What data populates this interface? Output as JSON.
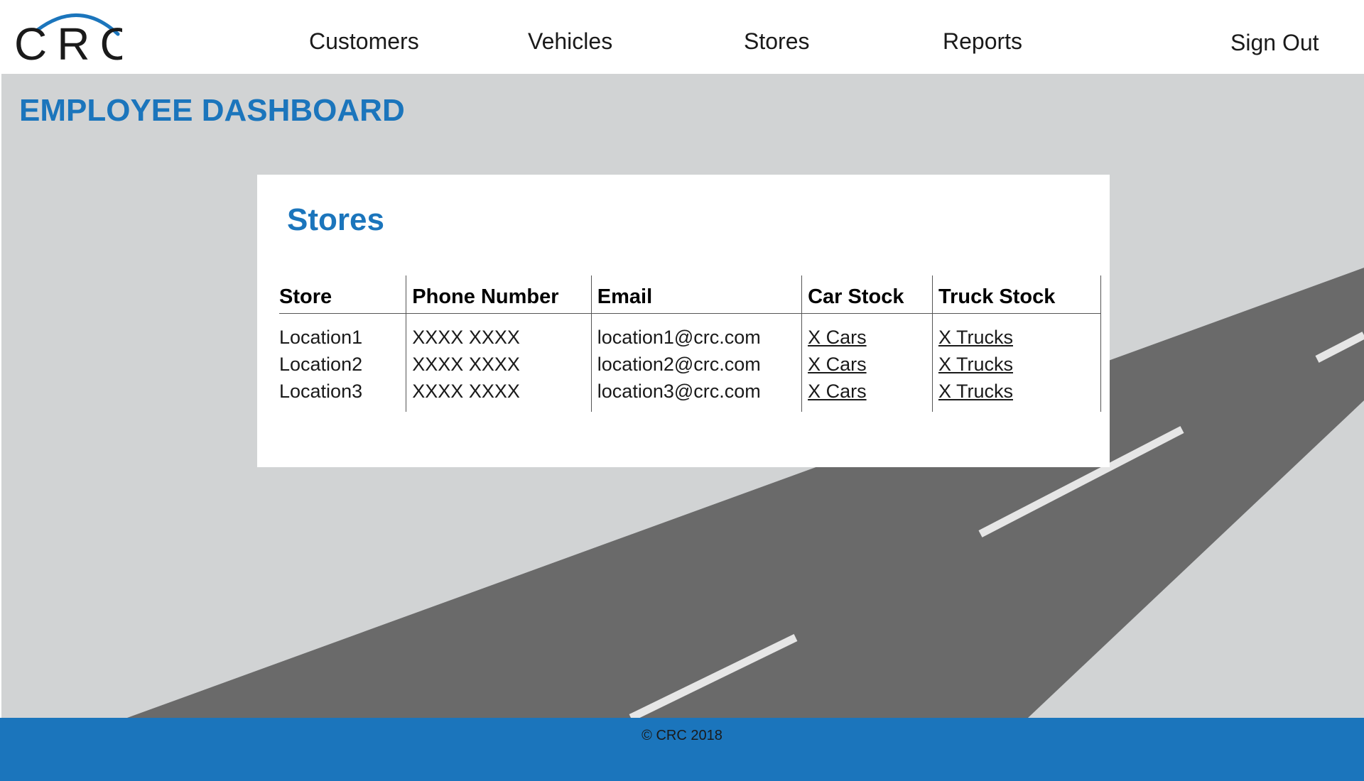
{
  "header": {
    "logo_text": "CRC",
    "nav": {
      "customers": "Customers",
      "vehicles": "Vehicles",
      "stores": "Stores",
      "reports": "Reports"
    },
    "sign_out": "Sign Out"
  },
  "page": {
    "title": "EMPLOYEE DASHBOARD"
  },
  "stores_card": {
    "title": "Stores",
    "columns": {
      "store": "Store",
      "phone": "Phone Number",
      "email": "Email",
      "car_stock": "Car Stock",
      "truck_stock": "Truck Stock"
    },
    "rows": [
      {
        "store": "Location1",
        "phone": "XXXX XXXX",
        "email": "location1@crc.com",
        "car_stock": "X Cars",
        "truck_stock": "X Trucks"
      },
      {
        "store": "Location2",
        "phone": "XXXX XXXX",
        "email": "location2@crc.com",
        "car_stock": "X Cars",
        "truck_stock": "X Trucks"
      },
      {
        "store": "Location3",
        "phone": "XXXX XXXX",
        "email": "location3@crc.com",
        "car_stock": "X Cars",
        "truck_stock": "X Trucks"
      }
    ]
  },
  "footer": {
    "copyright": "© CRC 2018"
  },
  "colors": {
    "brand_blue": "#1b75bc",
    "background_gray": "#d1d3d4",
    "road_gray": "#6a6a6a",
    "lane_marking": "#e6e6e6"
  },
  "icons": {
    "logo": "crc-logo-arc-icon",
    "background": "road-illustration"
  }
}
